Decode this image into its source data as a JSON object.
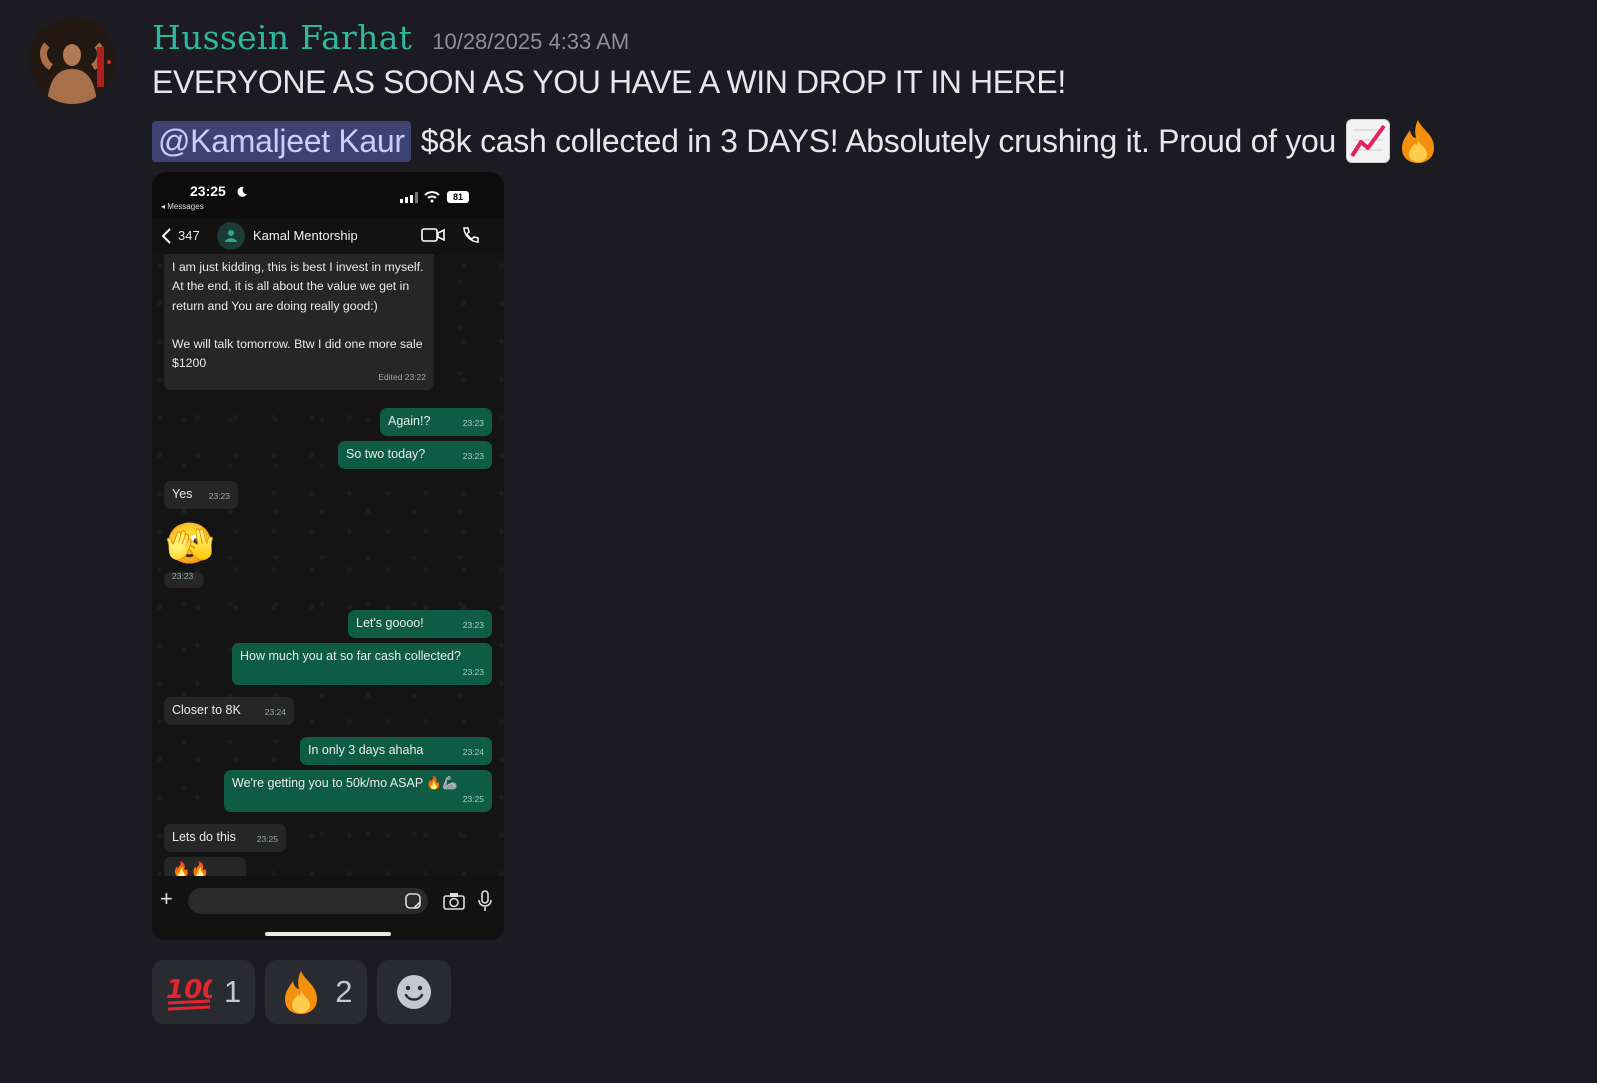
{
  "message": {
    "author": "Hussein Farhat",
    "timestamp": "10/28/2025 4:33 AM",
    "line1": "EVERYONE AS SOON AS YOU HAVE A WIN DROP IT IN HERE!",
    "mention": "@Kamaljeet Kaur",
    "line2_text": "$8k cash collected in 3 DAYS! Absolutely crushing it. Proud of you",
    "line2_emojis": [
      "chart-increasing-emoji",
      "fire-emoji"
    ]
  },
  "phone": {
    "time": "23:25",
    "back_label": "◂ Messages",
    "battery": "81",
    "unread_count": "347",
    "contact_name": "Kamal Mentorship",
    "messages": [
      {
        "dir": "in",
        "text": "I am just kidding, this is best I invest in myself. At the end, it is all about the value we get in return and You are doing really good:)\n\nWe will talk tomorrow. Btw I did one more sale $1200",
        "time": "Edited 23:22"
      },
      {
        "dir": "out",
        "text": "Again!?",
        "time": "23:23"
      },
      {
        "dir": "out",
        "text": "So two today?",
        "time": "23:23"
      },
      {
        "dir": "in",
        "text": "Yes",
        "time": "23:23"
      },
      {
        "dir": "in",
        "text": "🫣",
        "time": "23:23"
      },
      {
        "dir": "out",
        "text": "Let's goooo!",
        "time": "23:23"
      },
      {
        "dir": "out",
        "text": "How much you at so far cash collected?",
        "time": "23:23"
      },
      {
        "dir": "in",
        "text": "Closer to 8K",
        "time": "23:24"
      },
      {
        "dir": "out",
        "text": "In only 3 days ahaha",
        "time": "23:24"
      },
      {
        "dir": "out",
        "text": "We're getting you to 50k/mo ASAP 🔥🦾",
        "time": "23:25"
      },
      {
        "dir": "in",
        "text": "Lets do this",
        "time": "23:25"
      }
    ]
  },
  "reactions": [
    {
      "emoji": "hundred-points-emoji",
      "count": "1"
    },
    {
      "emoji": "fire-emoji",
      "count": "2"
    }
  ],
  "colors": {
    "background": "#1b1b21",
    "username": "#2fb7a0",
    "mention_bg": "#3d4270",
    "outgoing_bubble": "#0f5c45",
    "incoming_bubble": "#262626"
  }
}
